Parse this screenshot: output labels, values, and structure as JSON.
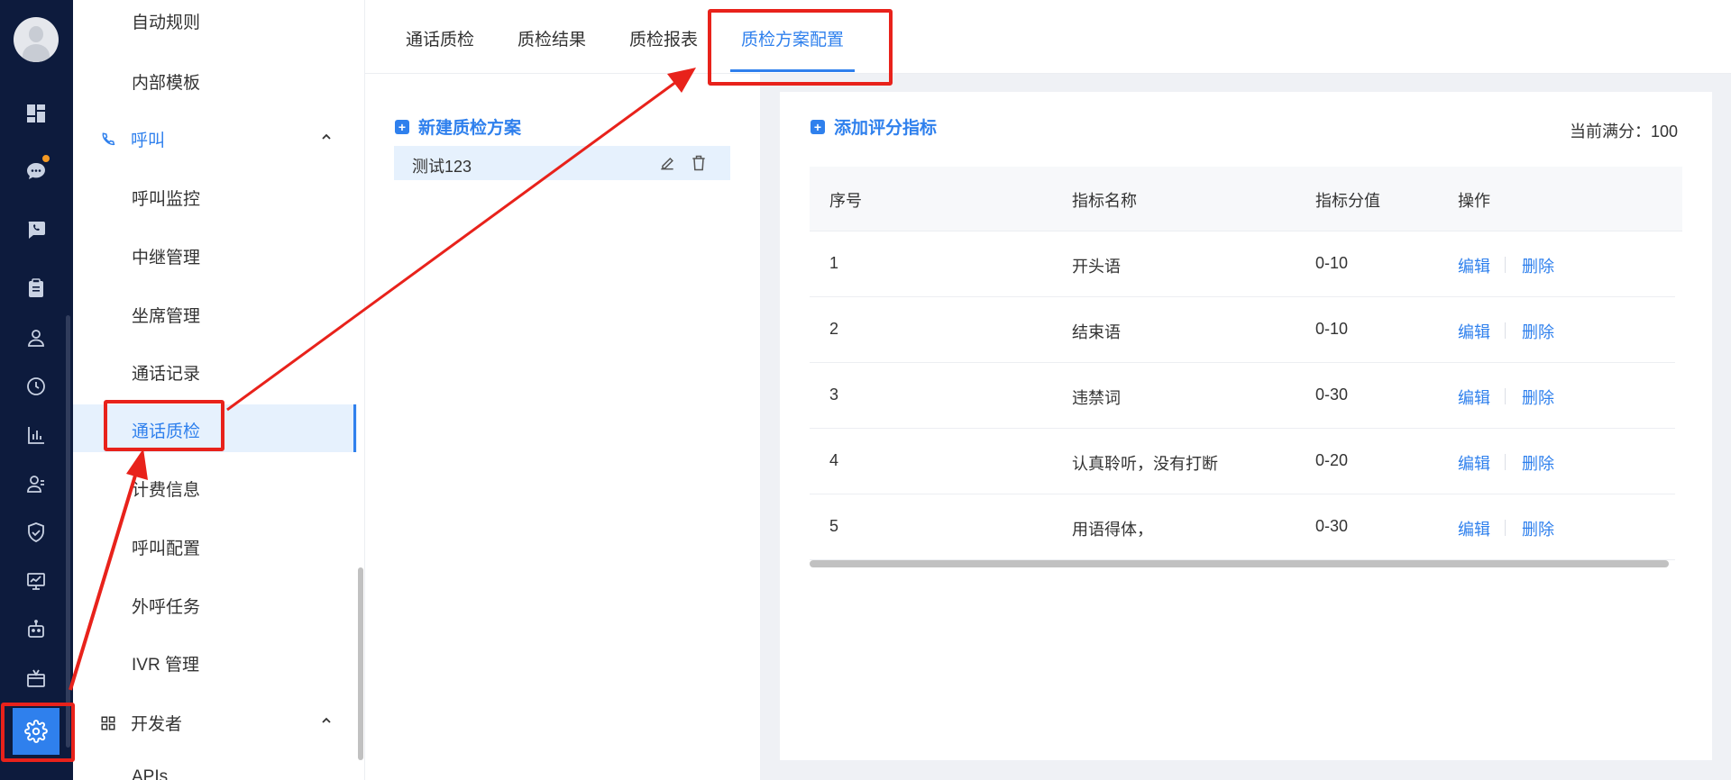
{
  "sidebar": {
    "items": [
      {
        "label": "自动规则"
      },
      {
        "label": "内部模板"
      },
      {
        "label": "呼叫监控"
      },
      {
        "label": "中继管理"
      },
      {
        "label": "坐席管理"
      },
      {
        "label": "通话记录"
      },
      {
        "label": "通话质检"
      },
      {
        "label": "计费信息"
      },
      {
        "label": "呼叫配置"
      },
      {
        "label": "外呼任务"
      },
      {
        "label": "IVR 管理"
      },
      {
        "label": "APIs"
      }
    ],
    "groups": {
      "call": "呼叫",
      "developer": "开发者"
    }
  },
  "tabs": [
    {
      "label": "通话质检"
    },
    {
      "label": "质检结果"
    },
    {
      "label": "质检报表"
    },
    {
      "label": "质检方案配置"
    }
  ],
  "schemes": {
    "add_label": "新建质检方案",
    "items": [
      {
        "name": "测试123"
      }
    ]
  },
  "metrics": {
    "add_label": "添加评分指标",
    "score_text": "当前满分：100",
    "columns": [
      "序号",
      "指标名称",
      "指标分值",
      "操作"
    ],
    "edit_label": "编辑",
    "delete_label": "删除",
    "rows": [
      {
        "no": "1",
        "name": "开头语",
        "range": "0-10"
      },
      {
        "no": "2",
        "name": "结束语",
        "range": "0-10"
      },
      {
        "no": "3",
        "name": "违禁词",
        "range": "0-30"
      },
      {
        "no": "4",
        "name": "认真聆听，没有打断",
        "range": "0-20"
      },
      {
        "no": "5",
        "name": "用语得体，",
        "range": "0-30"
      }
    ]
  },
  "colors": {
    "accent": "#2f80ed",
    "rail_bg": "#0d1b3d",
    "annotation": "#e8221b"
  }
}
